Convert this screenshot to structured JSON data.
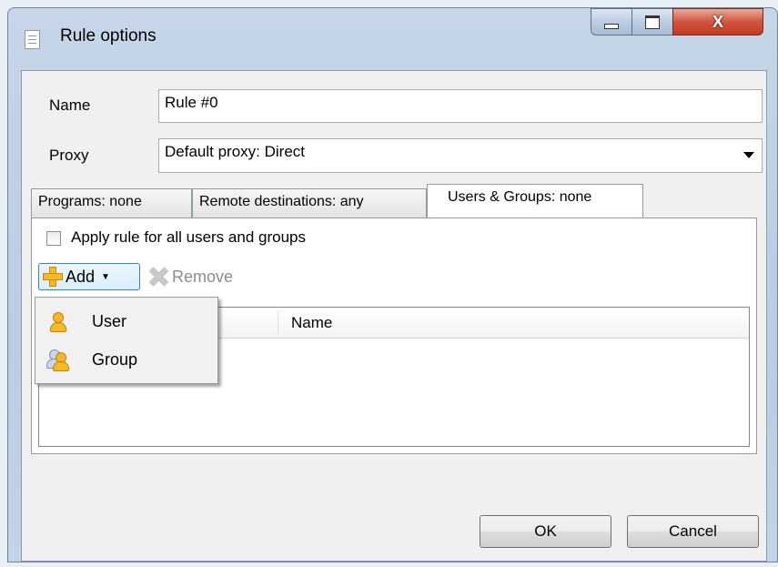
{
  "window": {
    "title": "Rule options",
    "close_glyph": "X"
  },
  "form": {
    "name_label": "Name",
    "name_value": "Rule #0",
    "proxy_label": "Proxy",
    "proxy_value": "Default proxy: Direct"
  },
  "tabs": [
    {
      "label": "Programs: none"
    },
    {
      "label": "Remote destinations: any"
    },
    {
      "label": "Users & Groups: none"
    }
  ],
  "users_groups": {
    "apply_all_label": "Apply rule for all users and groups",
    "add_label": "Add",
    "remove_label": "Remove",
    "column_name": "Name"
  },
  "add_menu": [
    {
      "label": "User",
      "icon": "user-icon"
    },
    {
      "label": "Group",
      "icon": "group-icon"
    }
  ],
  "buttons": {
    "ok": "OK",
    "cancel": "Cancel"
  },
  "colors": {
    "icon_accent": "#f5b82a",
    "close_button": "#c9442c",
    "title_bar": "#bccde1"
  }
}
